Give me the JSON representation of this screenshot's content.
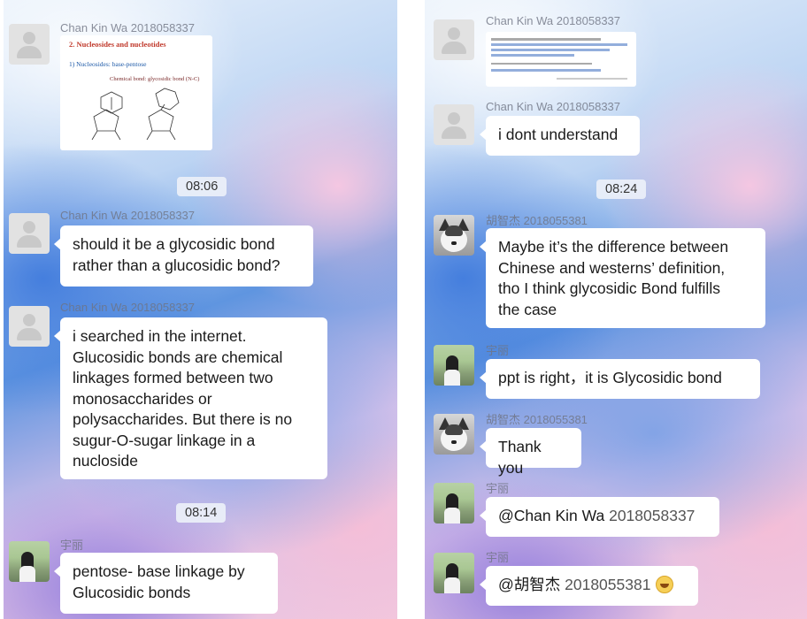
{
  "left_chat": {
    "msg1": {
      "sender": "Chan Kin Wa 2018058337",
      "slide": {
        "title": "2. Nucleosides and nucleotides",
        "subtitle": "1) Nucleosides: base-pentose",
        "note": "Chemical bond: glycosidic bond (N-C)"
      }
    },
    "time1": "08:06",
    "msg2": {
      "sender": "Chan Kin Wa 2018058337",
      "text": "should it be a glycosidic bond\nrather than a glucosidic bond?"
    },
    "msg3": {
      "sender": "Chan Kin Wa 2018058337",
      "text": "i searched in the internet.\nGlucosidic bonds are chemical\nlinkages formed between two\nmonosaccharides or\npolysaccharides. But there is no\nsugur-O-sugar linkage in a\nnucloside"
    },
    "time2": "08:14",
    "msg4": {
      "sender": "宇丽",
      "text": "pentose- base linkage by\nGlucosidic bonds"
    }
  },
  "right_chat": {
    "msg1": {
      "sender": "Chan Kin Wa 2018058337"
    },
    "msg2": {
      "sender": "Chan Kin Wa 2018058337",
      "text": "i dont understand"
    },
    "time1": "08:24",
    "msg3": {
      "sender": "胡智杰 2018055381",
      "text": "Maybe it’s the difference between\nChinese and westerns’ definition,\ntho I think glycosidic Bond fulfills\nthe case"
    },
    "msg4": {
      "sender": "宇丽",
      "text": "ppt is right，it is Glycosidic bond"
    },
    "msg5": {
      "sender": "胡智杰 2018055381",
      "text": "Thank you"
    },
    "msg6": {
      "sender": "宇丽",
      "mention": "@Chan Kin Wa",
      "number": " 2018058337"
    },
    "msg7": {
      "sender": "宇丽",
      "mention": "@胡智杰",
      "number": " 2018055381"
    }
  }
}
